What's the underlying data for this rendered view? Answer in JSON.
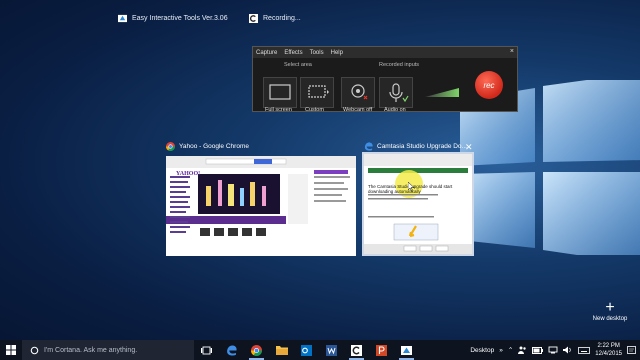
{
  "top_apps": [
    {
      "label": "Easy Interactive Tools Ver.3.06",
      "icon": "easy-interactive-tools-icon"
    },
    {
      "label": "Recording...",
      "icon": "camtasia-recorder-icon"
    }
  ],
  "recorder": {
    "menu": [
      "Capture",
      "Effects",
      "Tools",
      "Help"
    ],
    "close_glyph": "×",
    "select_area_title": "Select area",
    "recorded_inputs_title": "Recorded inputs",
    "full_screen_label": "Full screen",
    "custom_label": "Custom",
    "webcam_label": "Webcam off",
    "audio_label": "Audio on",
    "rec_label": "rec",
    "accent": "#e0382a"
  },
  "task_view": {
    "chrome_title": "Yahoo - Google Chrome",
    "camtasia_title": "Camtasia Studio Upgrade Do...",
    "close_glyph": "✕",
    "yahoo_logo": "YAHOO!",
    "camtasia_heading_line1": "The Camtasia Studio upgrade should start",
    "camtasia_heading_line2": "downloading automatically"
  },
  "new_desktop": {
    "plus": "+",
    "label": "New desktop"
  },
  "taskbar": {
    "cortana_placeholder": "I'm Cortana. Ask me anything.",
    "tray_desktop": "Desktop",
    "time": "2:22 PM",
    "date": "12/4/2015",
    "accent": "#0078d7"
  }
}
